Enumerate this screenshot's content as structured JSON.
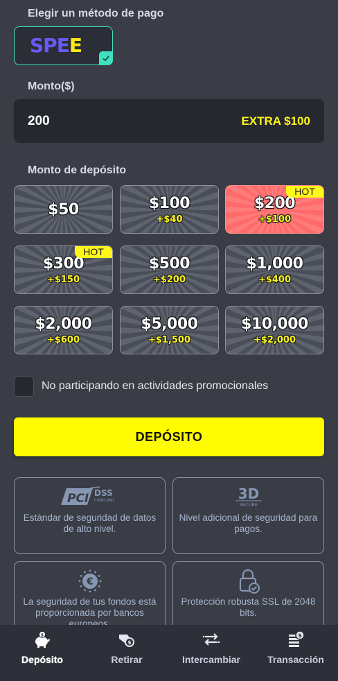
{
  "method_section": {
    "title": "Elegir un método de pago",
    "selected_method": {
      "logo_text_a": "SPE",
      "logo_text_b": "E",
      "icon": "check-icon"
    }
  },
  "amount_section": {
    "title": "Monto($)",
    "value": "200",
    "extra_prefix": "EXTRA ",
    "extra_amount": "$100"
  },
  "deposit_amounts": {
    "title": "Monto de depósito",
    "hot_label": "HOT",
    "tiles": [
      {
        "amount": "$50",
        "bonus": "",
        "hot": false,
        "selected": false
      },
      {
        "amount": "$100",
        "bonus": "+$40",
        "hot": false,
        "selected": false
      },
      {
        "amount": "$200",
        "bonus": "+$100",
        "hot": true,
        "selected": true
      },
      {
        "amount": "$300",
        "bonus": "+$150",
        "hot": true,
        "selected": false
      },
      {
        "amount": "$500",
        "bonus": "+$200",
        "hot": false,
        "selected": false
      },
      {
        "amount": "$1,000",
        "bonus": "+$400",
        "hot": false,
        "selected": false
      },
      {
        "amount": "$2,000",
        "bonus": "+$600",
        "hot": false,
        "selected": false
      },
      {
        "amount": "$5,000",
        "bonus": "+$1,500",
        "hot": false,
        "selected": false
      },
      {
        "amount": "$10,000",
        "bonus": "+$2,000",
        "hot": false,
        "selected": false
      }
    ]
  },
  "promo": {
    "label": "No participando en actividades promocionales",
    "checked": false
  },
  "deposit_button": {
    "label": "DEPÓSITO"
  },
  "security": [
    {
      "icon": "pci-dss-icon",
      "badge_a": "DSS",
      "badge_b": "COMPLIANT",
      "text": "Estándar de seguridad de datos de alto nivel."
    },
    {
      "icon": "3d-secure-icon",
      "badge_a": "3D",
      "badge_b": "SECURE",
      "text": "Nivel adicional de seguridad para pagos."
    },
    {
      "icon": "euro-shield-icon",
      "text": "La seguridad de tus fondos está proporcionada por bancos europeos."
    },
    {
      "icon": "lock-check-icon",
      "text": "Protección robusta SSL de 2048 bits."
    }
  ],
  "bottom_nav": [
    {
      "label": "Depósito",
      "icon": "piggy-bank-icon",
      "active": true
    },
    {
      "label": "Retirar",
      "icon": "withdraw-icon",
      "active": false
    },
    {
      "label": "Intercambiar",
      "icon": "exchange-icon",
      "active": false
    },
    {
      "label": "Transacción",
      "icon": "transaction-icon",
      "active": false
    }
  ],
  "colors": {
    "background": "#3a3d46",
    "accent_yellow": "#fffb00",
    "selected_tile": "#ff7c7c",
    "teal": "#3fe0c0"
  }
}
